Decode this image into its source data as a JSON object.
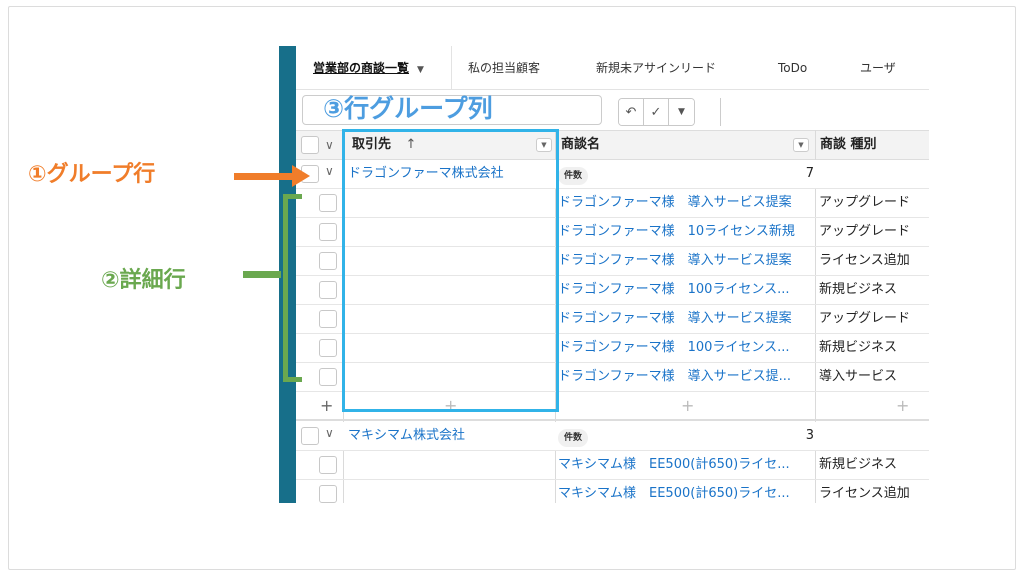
{
  "tabs": [
    {
      "label": "営業部の商談一覧",
      "active": true
    },
    {
      "label": "私の担当顧客"
    },
    {
      "label": "新規未アサインリード"
    },
    {
      "label": "ToDo"
    },
    {
      "label": "ユーザ"
    }
  ],
  "toolbar": {
    "undo": "↶",
    "check": "✓",
    "dropdown": "▼"
  },
  "columns": {
    "account": "取引先",
    "sort_arrow": "↑",
    "opportunity": "商談名",
    "type": "商談 種別"
  },
  "groups": [
    {
      "name": "ドラゴンファーマ株式会社",
      "count_label": "件数",
      "count": "7",
      "rows": [
        {
          "opportunity": "ドラゴンファーマ様　導入サービス提案",
          "type": "アップグレード"
        },
        {
          "opportunity": "ドラゴンファーマ様　10ライセンス新規",
          "type": "アップグレード"
        },
        {
          "opportunity": "ドラゴンファーマ様　導入サービス提案",
          "type": "ライセンス追加"
        },
        {
          "opportunity": "ドラゴンファーマ様　100ライセンス...",
          "type": "新規ビジネス"
        },
        {
          "opportunity": "ドラゴンファーマ様　導入サービス提案",
          "type": "アップグレード"
        },
        {
          "opportunity": "ドラゴンファーマ様　100ライセンス...",
          "type": "新規ビジネス"
        },
        {
          "opportunity": "ドラゴンファーマ様　導入サービス提...",
          "type": "導入サービス"
        }
      ]
    },
    {
      "name": "マキシマム株式会社",
      "count_label": "件数",
      "count": "3",
      "rows": [
        {
          "opportunity": "マキシマム様　EE500(計650)ライセ...",
          "type": "新規ビジネス"
        },
        {
          "opportunity": "マキシマム様　EE500(計650)ライセ...",
          "type": "ライセンス追加"
        }
      ]
    }
  ],
  "add_symbol": "+",
  "annotations": {
    "group_row": "①グループ行",
    "detail_row": "②詳細行",
    "row_group_column": "③行グループ列"
  },
  "colors": {
    "accent_orange": "#f07d2a",
    "accent_green": "#6aa84f",
    "accent_blue": "#31b3e8",
    "sidebar": "#176f8a",
    "link": "#1a73c8"
  }
}
